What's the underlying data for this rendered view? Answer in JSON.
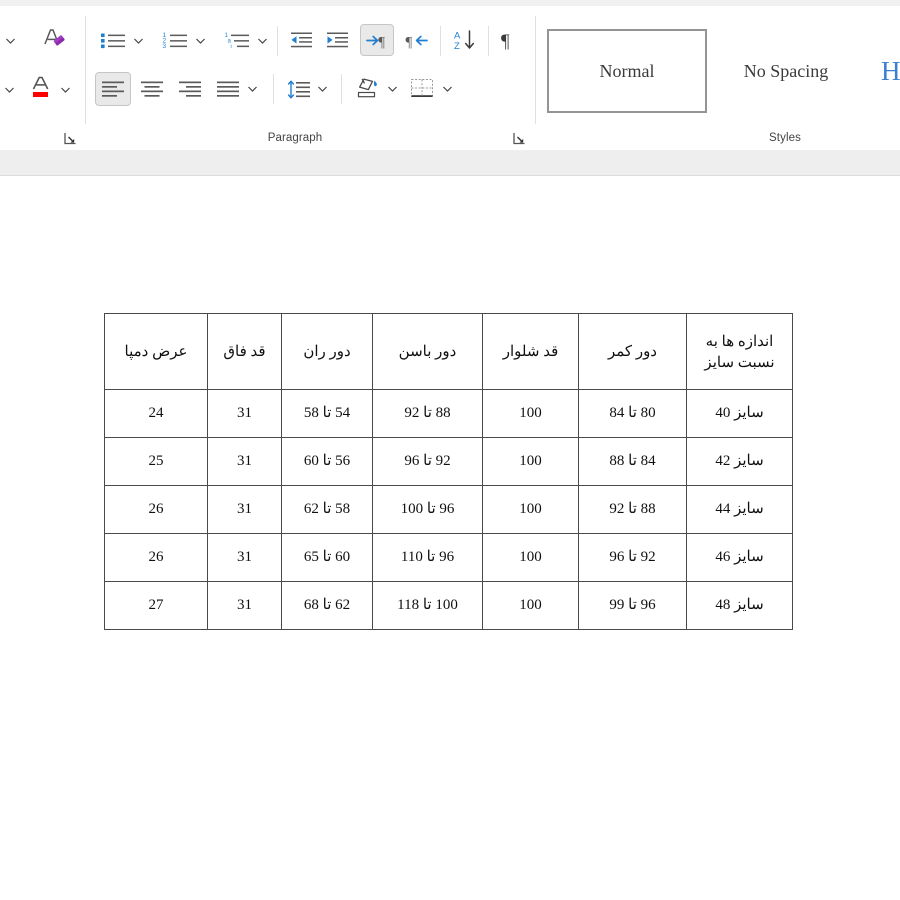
{
  "window": {
    "app": "Microsoft Word",
    "document_area_background": "#ffffff",
    "ribbon_background": "#ffffff"
  },
  "ribbon": {
    "groups": [
      {
        "id": "font",
        "label": ""
      },
      {
        "id": "paragraph",
        "label": "Paragraph"
      },
      {
        "id": "styles",
        "label": "Styles"
      }
    ],
    "font_group": {
      "buttons": [
        {
          "name": "font-size-caret",
          "icon": "chevron-down-icon",
          "tooltip": ""
        },
        {
          "name": "clear-formatting",
          "icon": "clear-formatting-icon",
          "tooltip": "Clear All Formatting"
        },
        {
          "name": "text-effects-caret",
          "icon": "chevron-down-icon",
          "tooltip": ""
        },
        {
          "name": "font-color",
          "icon": "font-color-icon",
          "tooltip": "Font Color",
          "swatch": "#ff0000"
        },
        {
          "name": "font-color-caret",
          "icon": "chevron-down-icon",
          "tooltip": ""
        }
      ],
      "dialog_launcher": "font-dialog-launcher"
    },
    "paragraph_group": {
      "label": "Paragraph",
      "row1": [
        {
          "name": "bullets-button",
          "icon": "bullet-list-icon",
          "label": "Bullets",
          "has_caret": true,
          "active": false
        },
        {
          "name": "numbering-button",
          "icon": "numbered-list-icon",
          "label": "Numbering",
          "has_caret": true,
          "active": false
        },
        {
          "name": "multilevel-list-button",
          "icon": "multilevel-list-icon",
          "label": "Multilevel List",
          "has_caret": true,
          "active": false
        },
        {
          "name": "decrease-indent-button",
          "icon": "decrease-indent-icon",
          "label": "Decrease Indent",
          "has_caret": false,
          "active": false
        },
        {
          "name": "increase-indent-button",
          "icon": "increase-indent-icon",
          "label": "Increase Indent",
          "has_caret": false,
          "active": false
        },
        {
          "name": "rtl-text-direction-button",
          "icon": "right-to-left-paragraph-icon",
          "label": "Right-to-Left Text Direction",
          "has_caret": false,
          "active": true
        },
        {
          "name": "ltr-text-direction-button",
          "icon": "left-to-right-paragraph-icon",
          "label": "Left-to-Right Text Direction",
          "has_caret": false,
          "active": false
        },
        {
          "name": "sort-button",
          "icon": "sort-az-icon",
          "label": "Sort",
          "has_caret": false,
          "active": false
        },
        {
          "name": "show-formatting-marks-button",
          "icon": "pilcrow-icon",
          "label": "Show/Hide Formatting Marks",
          "has_caret": false,
          "active": false
        }
      ],
      "row2": [
        {
          "name": "align-left-button",
          "icon": "align-left-icon",
          "label": "Align Left",
          "has_caret": false,
          "active": true
        },
        {
          "name": "align-center-button",
          "icon": "align-center-icon",
          "label": "Center",
          "has_caret": false,
          "active": false
        },
        {
          "name": "align-right-button",
          "icon": "align-right-icon",
          "label": "Align Right",
          "has_caret": false,
          "active": false
        },
        {
          "name": "justify-button",
          "icon": "justify-icon",
          "label": "Justify",
          "has_caret": true,
          "active": false
        },
        {
          "name": "line-spacing-button",
          "icon": "line-spacing-icon",
          "label": "Line and Paragraph Spacing",
          "has_caret": true,
          "active": false
        },
        {
          "name": "shading-button",
          "icon": "paint-bucket-icon",
          "label": "Shading",
          "has_caret": true,
          "active": false
        },
        {
          "name": "borders-button",
          "icon": "borders-icon",
          "label": "Borders",
          "has_caret": true,
          "active": false
        }
      ],
      "dialog_launcher": "paragraph-dialog-launcher"
    },
    "styles_group": {
      "label": "Styles",
      "items": [
        {
          "name": "style-normal",
          "label": "Normal",
          "selected": true,
          "kind": "body"
        },
        {
          "name": "style-no-spacing",
          "label": "No Spacing",
          "selected": false,
          "kind": "body"
        },
        {
          "name": "style-heading-1",
          "label": "H",
          "selected": false,
          "kind": "heading",
          "accent": "#3c7fd0"
        }
      ]
    }
  },
  "document": {
    "table": {
      "name": "size-chart-table",
      "direction": "rtl",
      "headers": [
        "اندازه ها به نسبت سایز",
        "دور کمر",
        "قد شلوار",
        "دور باسن",
        "دور ران",
        "قد فاق",
        "عرض دمپا"
      ],
      "header_lines": [
        [
          "اندازه ها به",
          "نسبت سایز"
        ],
        [
          "دور کمر"
        ],
        [
          "قد شلوار"
        ],
        [
          "دور باسن"
        ],
        [
          "دور ران"
        ],
        [
          "قد فاق"
        ],
        [
          "عرض دمپا"
        ]
      ],
      "rows": [
        [
          "سایز 40",
          "80 تا 84",
          "100",
          "88 تا 92",
          "54 تا 58",
          "31",
          "24"
        ],
        [
          "سایز 42",
          "84 تا 88",
          "100",
          "92 تا 96",
          "56 تا 60",
          "31",
          "25"
        ],
        [
          "سایز 44",
          "88 تا 92",
          "100",
          "96 تا 100",
          "58 تا 62",
          "31",
          "26"
        ],
        [
          "سایز 46",
          "92 تا 96",
          "100",
          "96 تا 110",
          "60 تا 65",
          "31",
          "26"
        ],
        [
          "سایز 48",
          "96 تا 99",
          "100",
          "100 تا 118",
          "62 تا 68",
          "31",
          "27"
        ]
      ]
    }
  }
}
